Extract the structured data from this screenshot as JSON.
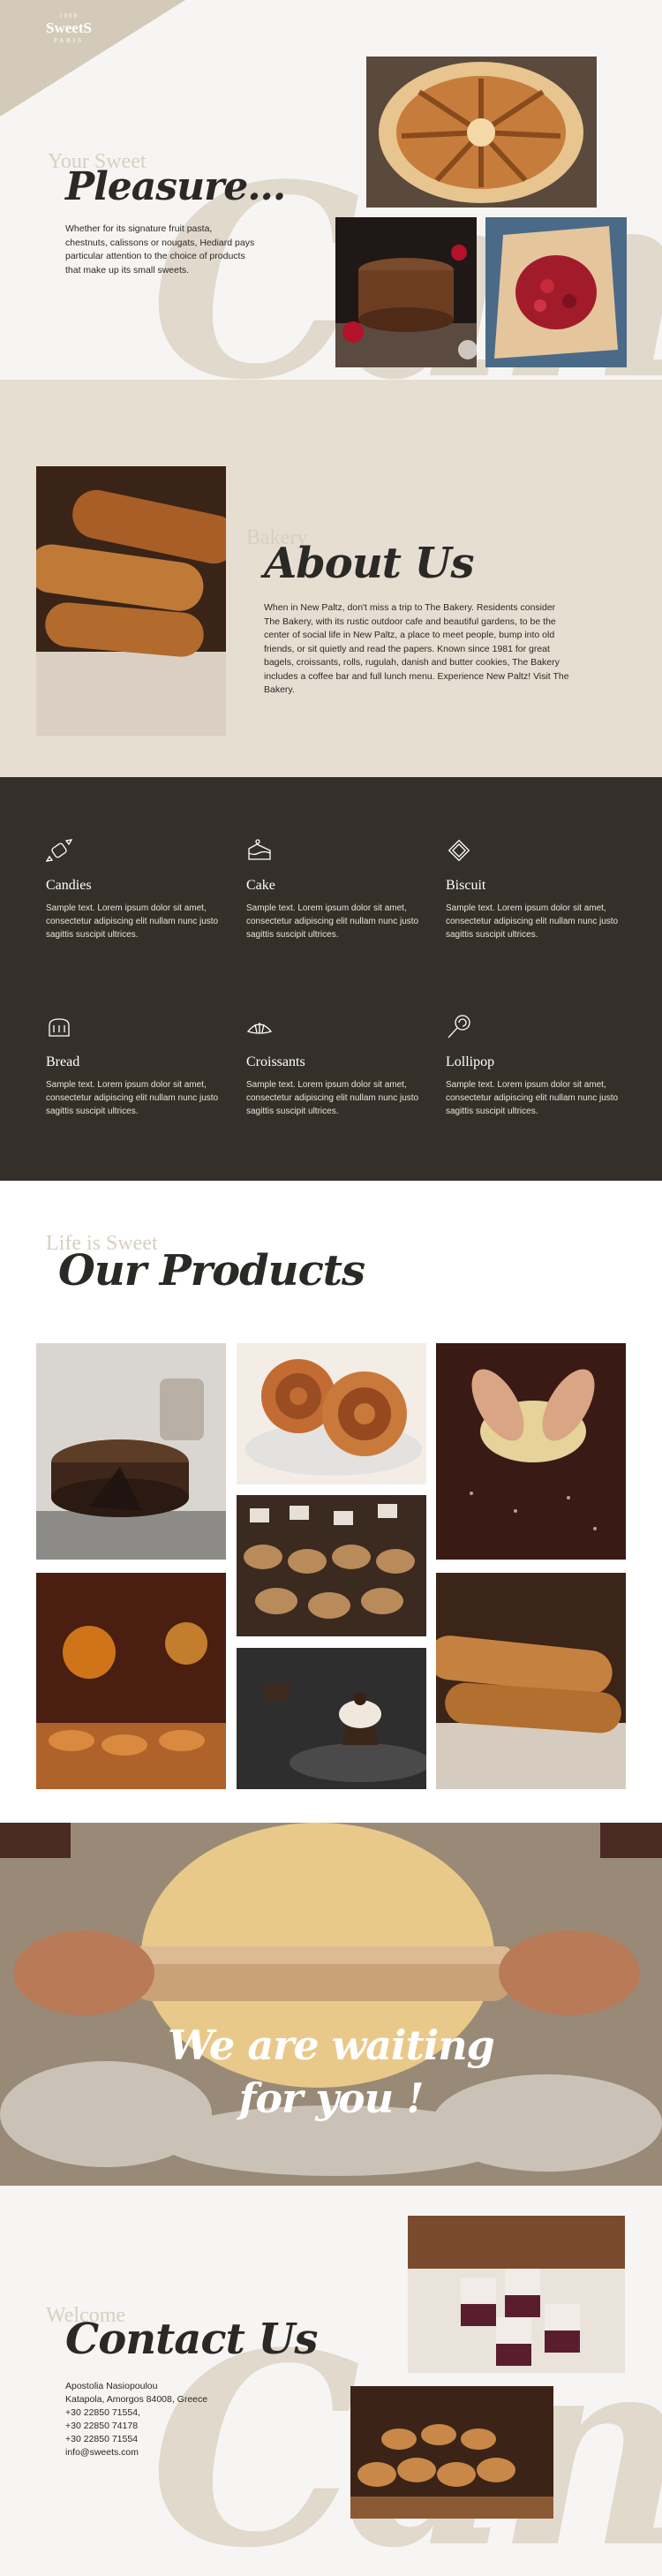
{
  "brand": {
    "year": "1990",
    "name": "SweetS",
    "city": "PARIS"
  },
  "hero": {
    "ghost": "Your Sweet",
    "title": "Pleasure...",
    "text": "Whether for its signature fruit pasta, chestnuts, calissons or nougats, Hediard pays particular attention to the choice of products that make up its small sweets.",
    "watermark": "Cand"
  },
  "about": {
    "ghost": "Bakery",
    "title": "About Us",
    "text": "When in New Paltz, don't miss a trip to The Bakery. Residents consider The Bakery, with its rustic outdoor cafe and beautiful gardens, to be the center of social life in New Paltz, a place to meet people, bump into old friends, or sit quietly and read the papers. Known since 1981 for great bagels, croissants, rolls, rugulah, danish and butter cookies, The Bakery includes a coffee bar and full lunch menu. Experience New Paltz! Visit The Bakery."
  },
  "features": [
    {
      "icon": "candy-icon",
      "title": "Candies",
      "text": "Sample text. Lorem ipsum dolor sit amet, consectetur adipiscing elit nullam nunc justo sagittis suscipit ultrices."
    },
    {
      "icon": "cake-icon",
      "title": "Cake",
      "text": "Sample text. Lorem ipsum dolor sit amet, consectetur adipiscing elit nullam nunc justo sagittis suscipit ultrices."
    },
    {
      "icon": "biscuit-icon",
      "title": "Biscuit",
      "text": "Sample text. Lorem ipsum dolor sit amet, consectetur adipiscing elit nullam nunc justo sagittis suscipit ultrices."
    },
    {
      "icon": "bread-icon",
      "title": "Bread",
      "text": "Sample text. Lorem ipsum dolor sit amet, consectetur adipiscing elit nullam nunc justo sagittis suscipit ultrices."
    },
    {
      "icon": "croissant-icon",
      "title": "Croissants",
      "text": "Sample text. Lorem ipsum dolor sit amet, consectetur adipiscing elit nullam nunc justo sagittis suscipit ultrices."
    },
    {
      "icon": "lollipop-icon",
      "title": "Lollipop",
      "text": "Sample text. Lorem ipsum dolor sit amet, consectetur adipiscing elit nullam nunc justo sagittis suscipit ultrices."
    }
  ],
  "products": {
    "ghost": "Life is Sweet",
    "title": "Our Products"
  },
  "waiting": {
    "line1": "We are waiting",
    "line2": "for you !"
  },
  "contact": {
    "ghost": "Welcome",
    "title": "Contact Us",
    "lines": [
      "Apostolia Nasiopoulou",
      "Katapola, Amorgos 84008, Greece",
      "+30 22850 71554,",
      "+30 22850 74178",
      "+30 22850 71554",
      "info@sweets.com"
    ],
    "watermark": "Cand"
  },
  "colors": {
    "beige": "#e5ded1",
    "dark": "#343029",
    "ghost": "#d7cfc2",
    "text": "#2b2926"
  }
}
